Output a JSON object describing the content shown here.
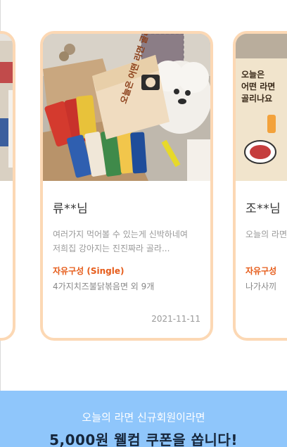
{
  "reviews": [
    {
      "author": "류**님",
      "review": "여러가지 먹어볼 수 있는게 신박하네여 저희집 강아지는 진진짜라 골라...",
      "option": "자유구성 (Single)",
      "product": "4가지치즈불닭볶음면 외 9개",
      "date": "2021-11-11",
      "box_text": "오늘은 어떤 라면 골리나요?"
    },
    {
      "author": "조**님",
      "review": "오늘의 라면 이 기뻥",
      "option": "자유구성",
      "product": "나가사끼",
      "box_text": "오늘은 어떤 라면 골리나요"
    }
  ],
  "banner": {
    "subtitle": "오늘의 라면 신규회원이라면",
    "title": "5,000원 웰컴 쿠폰을 쏩니다!"
  },
  "colors": {
    "card_border": "#fcd8b4",
    "option_text": "#e65c1a",
    "banner_bg": "#8fc6fb",
    "banner_title": "#16263b"
  }
}
